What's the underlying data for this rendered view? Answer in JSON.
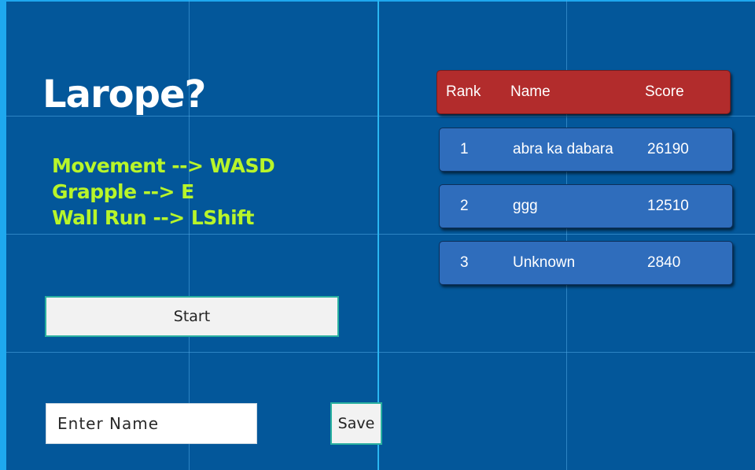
{
  "game": {
    "title": "Larope?",
    "controls": [
      "Movement --> WASD",
      "Grapple --> E",
      "Wall Run --> LShift"
    ],
    "start_label": "Start",
    "name_placeholder": "Enter Name",
    "save_label": "Save"
  },
  "leaderboard": {
    "headers": {
      "rank": "Rank",
      "name": "Name",
      "score": "Score"
    },
    "rows": [
      {
        "rank": "1",
        "name": "abra ka dabara",
        "score": "26190"
      },
      {
        "rank": "2",
        "name": "ggg",
        "score": "12510"
      },
      {
        "rank": "3",
        "name": "Unknown",
        "score": "2840"
      }
    ]
  },
  "colors": {
    "background": "#03579a",
    "controls_text": "#b8f52a",
    "header_red": "#b22c2c",
    "row_blue": "#2f6dbc",
    "frame_cyan": "#1ea8ef"
  }
}
